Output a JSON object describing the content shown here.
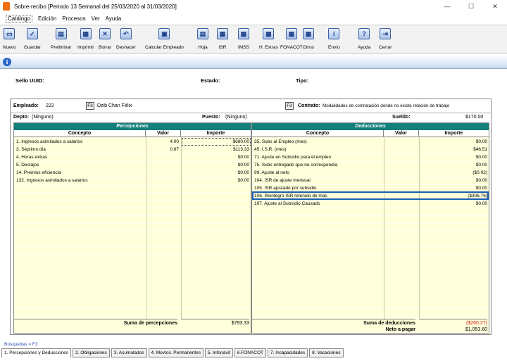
{
  "window": {
    "title": "Sobre-recibo  [Periodo 13 Semanal del 25/03/2020 al 31/03/2020]",
    "minimize": "—",
    "maximize": "☐",
    "close": "✕"
  },
  "menu": [
    "Catálogo",
    "Edición",
    "Procesos",
    "Ver",
    "Ayuda"
  ],
  "toolbar": [
    {
      "label": "Nuevo",
      "icon": "new-document-icon",
      "glyph": "▭"
    },
    {
      "label": "Guardar",
      "icon": "save-check-icon",
      "glyph": "✓"
    },
    {
      "label": "Preliminar",
      "icon": "preview-icon",
      "glyph": "▤"
    },
    {
      "label": "Imprimir",
      "icon": "print-icon",
      "glyph": "▦"
    },
    {
      "label": "Borrar",
      "icon": "delete-icon",
      "glyph": "✕"
    },
    {
      "label": "Deshacer",
      "icon": "undo-icon",
      "glyph": "↶"
    },
    {
      "label": "Calcular Empleado",
      "icon": "calculator-icon",
      "glyph": "▣"
    },
    {
      "label": "Hoja",
      "icon": "sheet-icon",
      "glyph": "▤"
    },
    {
      "label": "ISR",
      "icon": "isr-icon",
      "glyph": "▦"
    },
    {
      "label": "IMSS",
      "icon": "imss-icon",
      "glyph": "▦"
    },
    {
      "label": "H. Extras",
      "icon": "overtime-icon",
      "glyph": "▦"
    },
    {
      "label": "FONACOT",
      "icon": "fonacot-icon",
      "glyph": "▦"
    },
    {
      "label": "Otros",
      "icon": "others-icon",
      "glyph": "▦"
    },
    {
      "label": "Envío",
      "icon": "send-icon",
      "glyph": "i"
    },
    {
      "label": "Ayuda",
      "icon": "help-icon",
      "glyph": "?"
    },
    {
      "label": "Cerrar",
      "icon": "close-door-icon",
      "glyph": "⇥"
    }
  ],
  "header": {
    "sello_label": "Sello UUID:",
    "estado_label": "Estado:",
    "tipo_label": "Tipo:"
  },
  "employee": {
    "label": "Empleado:",
    "code": "222",
    "f3": "F3",
    "name": "Dzib Chan Félix",
    "contrato_label": "Contrato:",
    "contrato_value": "Modalidades de contratación donde no existe relación de trabajo",
    "depto_label": "Depto:",
    "depto_value": "(Ninguno)",
    "puesto_label": "Puesto:",
    "puesto_value": "(Ninguno)",
    "sueldo_label": "Sueldo:",
    "sueldo_value": "$170.00"
  },
  "percepciones": {
    "title": "Percepciones",
    "columns": [
      "Concepto",
      "Valor",
      "Importe"
    ],
    "rows": [
      {
        "concepto": "1. Ingresos asimilados a salarios",
        "valor": "4.00",
        "importe": "$680.00"
      },
      {
        "concepto": "3. Séptimo día",
        "valor": "0.67",
        "importe": "$113.33"
      },
      {
        "concepto": "4. Horas extras",
        "valor": "",
        "importe": "$0.00"
      },
      {
        "concepto": "5. Destajos",
        "valor": "",
        "importe": "$0.00"
      },
      {
        "concepto": "14. Premios eficiencia",
        "valor": "",
        "importe": "$0.00"
      },
      {
        "concepto": "132. Ingresos asimilados a  salarios",
        "valor": "",
        "importe": "$0.00"
      }
    ],
    "total_label": "Suma de percepciones",
    "total_value": "$793.33"
  },
  "deducciones": {
    "title": "Deducciones",
    "columns": [
      "Concepto",
      "Valor",
      "Importe"
    ],
    "rows": [
      {
        "concepto": "35. Subs al Empleo (mes)",
        "valor": "",
        "importe": "$0.00"
      },
      {
        "concepto": "45. I.S.R. (mes)",
        "valor": "",
        "importe": "$46.51"
      },
      {
        "concepto": "71. Ajuste en Subsidio para el empleo",
        "valor": "",
        "importe": "$0.00"
      },
      {
        "concepto": "75. Subs entregado que no correspondía",
        "valor": "",
        "importe": "$0.00"
      },
      {
        "concepto": "99. Ajuste al neto",
        "valor": "",
        "importe": "($0.02)"
      },
      {
        "concepto": "104. ISR de ajuste mensual",
        "valor": "",
        "importe": "$0.00"
      },
      {
        "concepto": "105. ISR ajustado por subsidio",
        "valor": "",
        "importe": "$0.00"
      },
      {
        "concepto": "106. Reintegro ISR retenido de mas",
        "valor": "",
        "importe": "($306.76)"
      },
      {
        "concepto": "107. Ajuste al Subsidio Causado",
        "valor": "",
        "importe": "$0.00"
      }
    ],
    "total_label": "Suma de deducciones",
    "total_value": "($260.27)",
    "neto_label": "Neto a pagar",
    "neto_value": "$1,053.60"
  },
  "busquedas": "Búsquedas = F3",
  "tabs": [
    "1. Percepciones y Deducciones",
    "2. Obligaciones",
    "3. Acumulados",
    "4. Movtos. Permanentes",
    "5. Infonavit",
    "6.FONACOT",
    "7. Incapacidades",
    "8. Vacaciones"
  ],
  "colors": {
    "header_bar": "#127f7a",
    "negative_total": "#d42020",
    "selection": "#1a5fb4"
  }
}
